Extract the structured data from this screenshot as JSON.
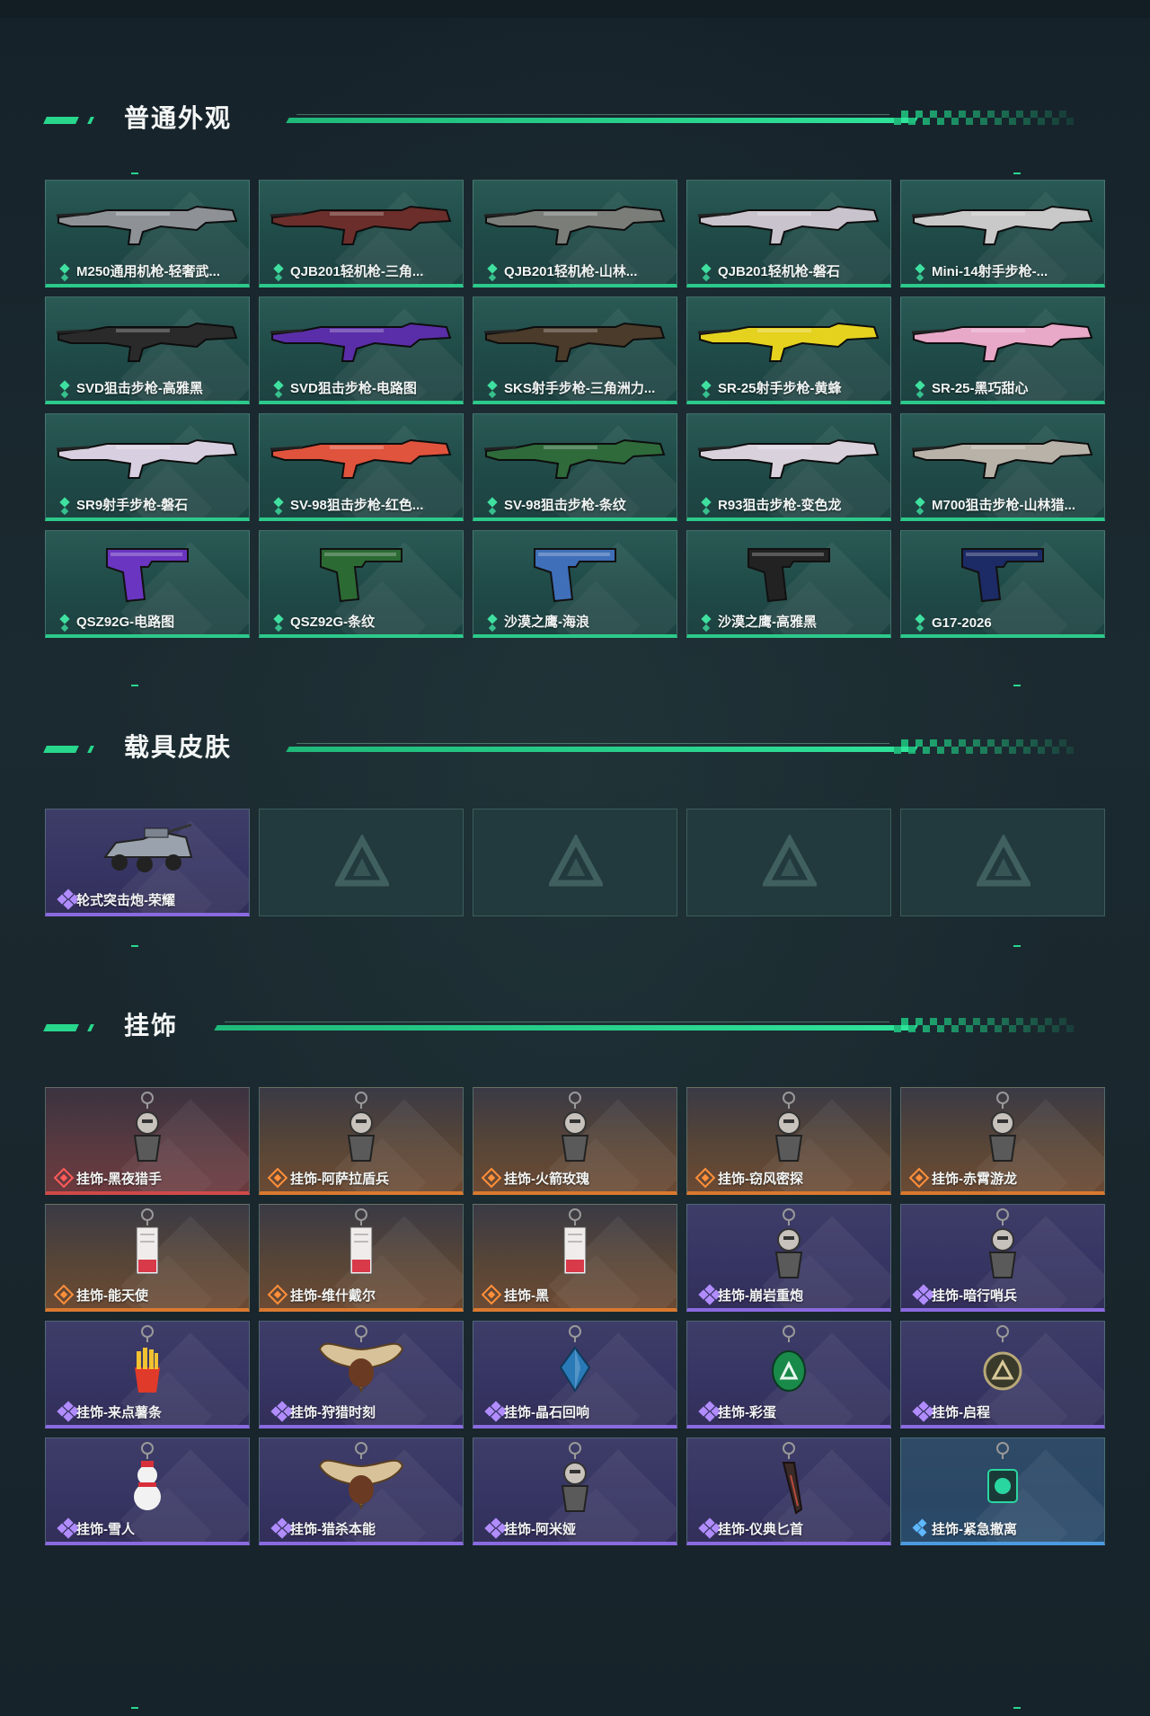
{
  "sections": {
    "weapons": {
      "title": "普通外观",
      "items": [
        {
          "label": "M250通用机枪-轻奢武...",
          "icon": "machine-gun-icon"
        },
        {
          "label": "QJB201轻机枪-三角...",
          "icon": "machine-gun-icon"
        },
        {
          "label": "QJB201轻机枪-山林...",
          "icon": "machine-gun-icon"
        },
        {
          "label": "QJB201轻机枪-磐石",
          "icon": "machine-gun-icon"
        },
        {
          "label": "Mini-14射手步枪-...",
          "icon": "rifle-icon"
        },
        {
          "label": "SVD狙击步枪-高雅黑",
          "icon": "sniper-rifle-icon"
        },
        {
          "label": "SVD狙击步枪-电路图",
          "icon": "sniper-rifle-icon"
        },
        {
          "label": "SKS射手步枪-三角洲力...",
          "icon": "rifle-icon"
        },
        {
          "label": "SR-25射手步枪-黄蜂",
          "icon": "rifle-icon"
        },
        {
          "label": "SR-25-黑巧甜心",
          "icon": "rifle-icon"
        },
        {
          "label": "SR9射手步枪-磐石",
          "icon": "rifle-icon"
        },
        {
          "label": "SV-98狙击步枪-红色...",
          "icon": "sniper-rifle-icon"
        },
        {
          "label": "SV-98狙击步枪-条纹",
          "icon": "sniper-rifle-icon"
        },
        {
          "label": "R93狙击步枪-变色龙",
          "icon": "sniper-rifle-icon"
        },
        {
          "label": "M700狙击步枪-山林猎...",
          "icon": "sniper-rifle-icon"
        },
        {
          "label": "QSZ92G-电路图",
          "icon": "pistol-icon"
        },
        {
          "label": "QSZ92G-条纹",
          "icon": "pistol-icon"
        },
        {
          "label": "沙漠之鹰-海浪",
          "icon": "pistol-icon"
        },
        {
          "label": "沙漠之鹰-高雅黑",
          "icon": "pistol-icon"
        },
        {
          "label": "G17-2026",
          "icon": "pistol-icon"
        }
      ]
    },
    "vehicles": {
      "title": "载具皮肤",
      "items": [
        {
          "label": "轮式突击炮-荣耀",
          "icon": "armored-vehicle-icon"
        }
      ]
    },
    "charms": {
      "title": "挂饰",
      "items": [
        {
          "label": "挂饰-黑夜猎手",
          "rarity": "red",
          "icon": "charm-figure-icon"
        },
        {
          "label": "挂饰-阿萨拉盾兵",
          "rarity": "orange",
          "icon": "charm-figure-icon"
        },
        {
          "label": "挂饰-火箭玫瑰",
          "rarity": "orange",
          "icon": "charm-figure-icon"
        },
        {
          "label": "挂饰-窃风密探",
          "rarity": "orange",
          "icon": "charm-figure-icon"
        },
        {
          "label": "挂饰-赤霄游龙",
          "rarity": "orange",
          "icon": "charm-figure-icon"
        },
        {
          "label": "挂饰-能天使",
          "rarity": "orange",
          "icon": "charm-tag-icon"
        },
        {
          "label": "挂饰-维什戴尔",
          "rarity": "orange",
          "icon": "charm-tag-icon"
        },
        {
          "label": "挂饰-黑",
          "rarity": "orange",
          "icon": "charm-tag-icon"
        },
        {
          "label": "挂饰-崩岩重炮",
          "rarity": "purple",
          "icon": "charm-figure-icon"
        },
        {
          "label": "挂饰-暗行哨兵",
          "rarity": "purple",
          "icon": "charm-figure-icon"
        },
        {
          "label": "挂饰-来点薯条",
          "rarity": "purple",
          "icon": "charm-fries-icon"
        },
        {
          "label": "挂饰-狩猎时刻",
          "rarity": "purple",
          "icon": "charm-antler-icon"
        },
        {
          "label": "挂饰-晶石回响",
          "rarity": "purple",
          "icon": "charm-crystal-icon"
        },
        {
          "label": "挂饰-彩蛋",
          "rarity": "purple",
          "icon": "charm-egg-icon"
        },
        {
          "label": "挂饰-启程",
          "rarity": "purple",
          "icon": "charm-medal-icon"
        },
        {
          "label": "挂饰-雪人",
          "rarity": "purple",
          "icon": "charm-snowman-icon"
        },
        {
          "label": "挂饰-猎杀本能",
          "rarity": "purple",
          "icon": "charm-antler-icon"
        },
        {
          "label": "挂饰-阿米娅",
          "rarity": "purple",
          "icon": "charm-figure-icon"
        },
        {
          "label": "挂饰-仪典匕首",
          "rarity": "purple",
          "icon": "charm-dagger-icon"
        },
        {
          "label": "挂饰-紧急撤离",
          "rarity": "blue",
          "icon": "charm-box-icon"
        }
      ]
    }
  },
  "colors": {
    "accent": "#28d68c",
    "rarity_green": "#2cc98b",
    "rarity_purple": "#8a6ae0",
    "rarity_orange": "#d9792f",
    "rarity_red": "#d04a4a",
    "rarity_blue": "#4c9be0"
  }
}
